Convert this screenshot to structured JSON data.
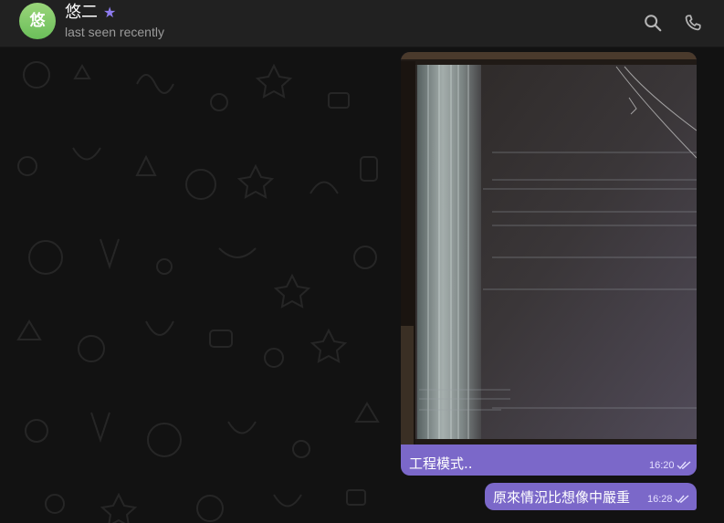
{
  "header": {
    "avatar_initial": "悠",
    "name": "悠二",
    "status": "last seen recently",
    "star_icon": "star-icon",
    "search_icon": "search-icon",
    "call_icon": "phone-icon",
    "accent": "#8e7cf0"
  },
  "messages": [
    {
      "type": "photo",
      "caption": "工程模式..",
      "time": "16:20",
      "status_icon": "double-check-icon"
    },
    {
      "type": "text",
      "text": "原來情況比想像中嚴重",
      "time": "16:28",
      "status_icon": "double-check-icon"
    }
  ],
  "colors": {
    "bubble": "#7b68c9",
    "header_bg": "#212121",
    "chat_bg": "#121212"
  }
}
